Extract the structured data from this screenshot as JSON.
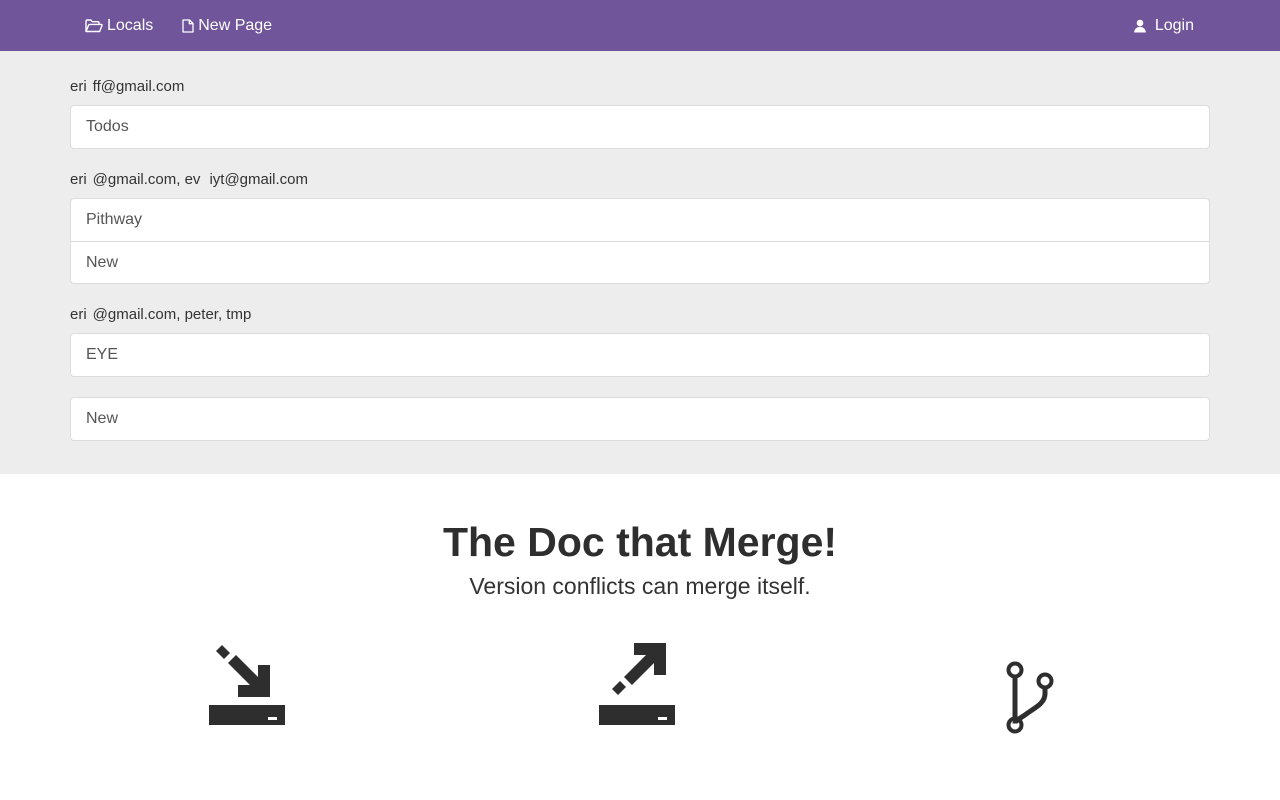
{
  "navbar": {
    "locals_label": "Locals",
    "new_page_label": "New Page",
    "login_label": "Login"
  },
  "documents": {
    "groups": [
      {
        "owners": "eri  ff@gmail.com",
        "items": [
          "Todos"
        ]
      },
      {
        "owners": "eri  @gmail.com, ev   iyt@gmail.com",
        "items": [
          "Pithway",
          "New"
        ]
      },
      {
        "owners": "eri  @gmail.com, peter, tmp",
        "items": [
          "EYE"
        ]
      }
    ],
    "new_label": "New"
  },
  "hero": {
    "title": "The Doc that Merge!",
    "subtitle": "Version conflicts can merge itself."
  },
  "icons": {
    "locals": "folder-open-icon",
    "new_page": "file-icon",
    "login": "user-icon",
    "features": [
      "download-icon",
      "upload-icon",
      "fork-icon"
    ]
  },
  "colors": {
    "navbar": "#70559a",
    "docs_background": "#ededed",
    "icon": "#2e2e2e"
  }
}
